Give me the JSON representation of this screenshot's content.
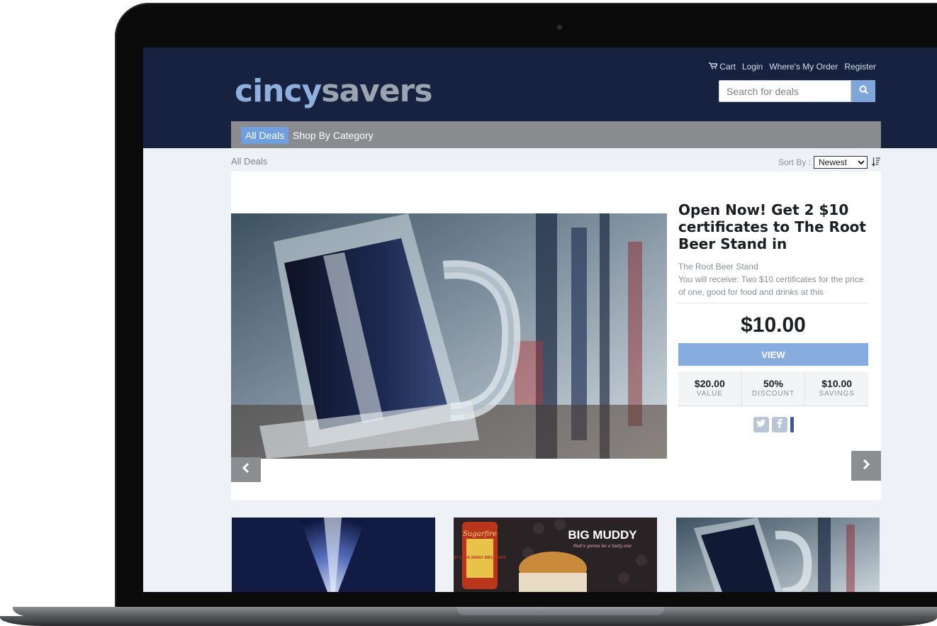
{
  "header": {
    "logo_cincy": "cincy",
    "logo_savers": "savers",
    "links": {
      "cart": "Cart",
      "login": "Login",
      "wheres_my_order": "Where's My Order",
      "register": "Register"
    },
    "search": {
      "placeholder": "Search for deals",
      "icon": "search-icon"
    }
  },
  "nav": {
    "items": [
      "All Deals",
      "Shop By Category"
    ],
    "active": "All Deals"
  },
  "breadcrumb": "All Deals",
  "sort": {
    "label": "Sort By :",
    "selected": "Newest",
    "options": [
      "Newest"
    ],
    "icon": "sort-icon"
  },
  "featured": {
    "title": "Open Now! Get 2 $10 certificates to The Root Beer Stand in",
    "merchant": "The Root Beer Stand",
    "description": "You will receive: Two $10 certificates for the price of one, good for food and drinks at this",
    "price": "$10.00",
    "view_label": "VIEW",
    "stats": [
      {
        "value": "$20.00",
        "label": "VALUE"
      },
      {
        "value": "50%",
        "label": "DISCOUNT"
      },
      {
        "value": "$10.00",
        "label": "SAVINGS"
      }
    ],
    "share_icons": [
      "twitter-icon",
      "facebook-icon"
    ]
  },
  "thumbnails": {
    "big_muddy": "BIG MUDDY",
    "big_muddy_tagline": "that's gonna be a tasty one",
    "sauce_brand": "Sugarfire",
    "sauce_label": "ST LOUIS SWEET BBQ SAUCE"
  },
  "colors": {
    "header_bg": "#16223f",
    "accent": "#87acdf",
    "nav_bg": "#8a8b8f"
  }
}
